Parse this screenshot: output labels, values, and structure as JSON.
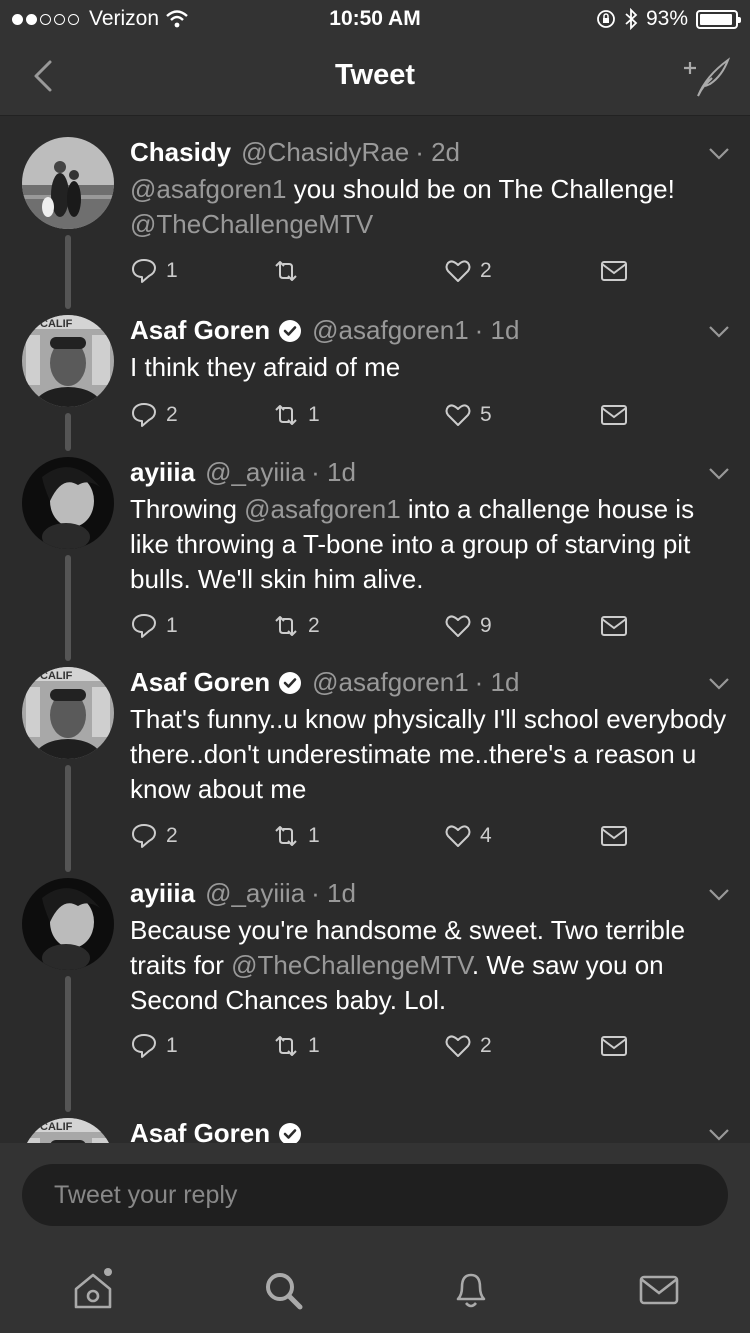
{
  "status": {
    "carrier": "Verizon",
    "time": "10:50 AM",
    "battery": "93%",
    "battery_level": 0.93
  },
  "nav": {
    "title": "Tweet",
    "back_icon": "chevron-left-icon",
    "compose_icon": "compose-tweet-icon"
  },
  "tweets": [
    {
      "name": "Chasidy",
      "verified": false,
      "handle": "@ChasidyRae",
      "age": "· 2d",
      "body": [
        {
          "type": "mention",
          "text": "@asafgoren1"
        },
        {
          "type": "text",
          "text": " you should be on The Challenge! "
        },
        {
          "type": "mention",
          "text": "@TheChallengeMTV"
        }
      ],
      "replies": "1",
      "retweets": "",
      "likes": "2"
    },
    {
      "name": "Asaf Goren",
      "verified": true,
      "handle": "@asafgoren1",
      "age": "· 1d",
      "body": [
        {
          "type": "text",
          "text": "I think they afraid of me"
        }
      ],
      "replies": "2",
      "retweets": "1",
      "likes": "5"
    },
    {
      "name": "ayiiia",
      "verified": false,
      "handle": "@_ayiiia",
      "age": "· 1d",
      "body": [
        {
          "type": "text",
          "text": "Throwing "
        },
        {
          "type": "mention",
          "text": "@asafgoren1"
        },
        {
          "type": "text",
          "text": " into a challenge house is like throwing a T-bone into a group of starving pit bulls. We'll skin him alive."
        }
      ],
      "replies": "1",
      "retweets": "2",
      "likes": "9"
    },
    {
      "name": "Asaf Goren",
      "verified": true,
      "handle": "@asafgoren1",
      "age": "· 1d",
      "body": [
        {
          "type": "text",
          "text": "That's funny..u know physically I'll school everybody there..don't underestimate me..there's a reason u know about me"
        }
      ],
      "replies": "2",
      "retweets": "1",
      "likes": "4"
    },
    {
      "name": "ayiiia",
      "verified": false,
      "handle": "@_ayiiia",
      "age": "· 1d",
      "body": [
        {
          "type": "text",
          "text": "Because you're handsome & sweet. Two terrible traits for "
        },
        {
          "type": "mention",
          "text": "@TheChallengeMTV"
        },
        {
          "type": "text",
          "text": ". We saw you on Second Chances baby. Lol."
        }
      ],
      "replies": "1",
      "retweets": "1",
      "likes": "2"
    },
    {
      "name": "Asaf Goren",
      "verified": true,
      "handle": "",
      "age": "",
      "body": [],
      "replies": "",
      "retweets": "",
      "likes": ""
    }
  ],
  "reply": {
    "placeholder": "Tweet your reply"
  },
  "tabs": [
    "home-icon",
    "search-icon",
    "notifications-icon",
    "messages-icon"
  ]
}
